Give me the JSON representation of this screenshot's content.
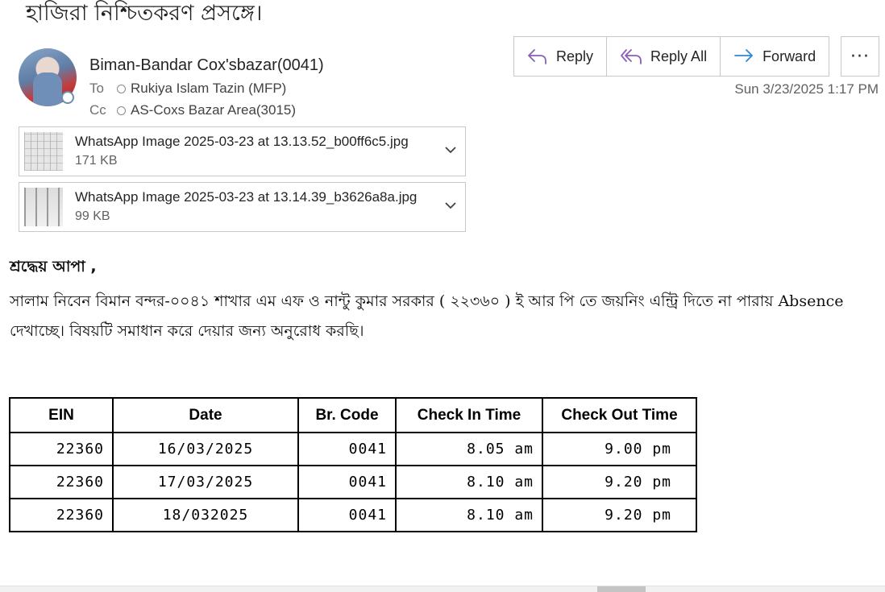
{
  "subject": "হাজিরা নিশ্চিতকরণ প্রসঙ্গে।",
  "sender": {
    "name": "Biman-Bandar Cox'sbazar(0041)",
    "to_label": "To",
    "to": "Rukiya Islam Tazin (MFP)",
    "cc_label": "Cc",
    "cc": "AS-Coxs Bazar Area(3015)"
  },
  "actions": {
    "reply": "Reply",
    "reply_all": "Reply All",
    "forward": "Forward",
    "more": "···"
  },
  "datetime": "Sun 3/23/2025 1:17 PM",
  "attachments": [
    {
      "name": "WhatsApp Image 2025-03-23 at 13.13.52_b00ff6c5.jpg",
      "size": "171 KB"
    },
    {
      "name": "WhatsApp Image 2025-03-23 at 13.14.39_b3626a8a.jpg",
      "size": "99 KB"
    }
  ],
  "body": {
    "greeting": "শ্রদ্ধেয় আপা ,",
    "line1": "সালাম নিবেন বিমান বন্দর-০০৪১  শাখার এম এফ ও নান্টু কুমার সরকার ( ২২৩৬০ ) ই আর পি তে জয়নিং এন্ট্রি দিতে না পারায় Absence",
    "line2": "দেখাচ্ছে। বিষয়টি সমাধান করে দেয়ার জন্য অনুরোধ করছি।"
  },
  "table": {
    "headers": [
      "EIN",
      "Date",
      "Br. Code",
      "Check In Time",
      "Check Out Time"
    ],
    "rows": [
      [
        "22360",
        "16/03/2025",
        "0041",
        "8.05  am",
        "9.00  pm"
      ],
      [
        "22360",
        "17/03/2025",
        "0041",
        "8.10  am",
        "9.20  pm"
      ],
      [
        "22360",
        "18/032025",
        "0041",
        "8.10  am",
        "9.20  pm"
      ]
    ]
  },
  "icons": {
    "reply": "reply-arrow-icon",
    "reply_all": "reply-all-arrow-icon",
    "forward": "forward-arrow-icon",
    "chevron": "chevron-down-icon"
  },
  "colors": {
    "accent": "#8a5fb8",
    "forward": "#2b88d8"
  }
}
